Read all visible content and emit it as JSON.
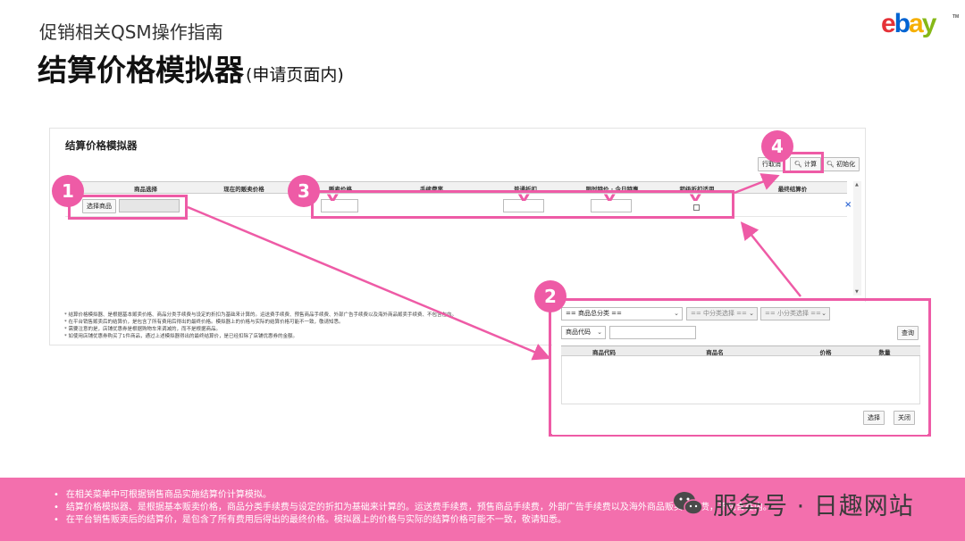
{
  "header": {
    "subtitle": "促销相关QSM操作指南",
    "title": "结算价格模拟器",
    "title_suffix": "(申请页面内)"
  },
  "logo": {
    "e": "e",
    "b": "b",
    "a": "a",
    "y": "y",
    "tm": "TM"
  },
  "simulator": {
    "title": "结算价格模拟器",
    "btn_add_row": "行取消",
    "btn_calculate": "计算",
    "btn_reset": "初始化",
    "columns": [
      "商品选择",
      "现在的贩卖价格",
      "贩卖价格",
      "手续费率",
      "普通折扣",
      "限时特价 · 今日特惠",
      "超级折扣适用",
      "最终结算价"
    ],
    "select_product_btn": "选择商品",
    "delete_icon": "×",
    "notes": [
      "* 结算价格模拟器、是根据基本贩卖价格、商品分类手续费与设定的折扣为基础来计算的。运送费手续费、预售商品手续费、外部广告手续费以及海外商品贩卖手续费、不包含在内。",
      "* 在平台销售贩卖后的结算价，是包含了所有费用后得出的最终价格。模拟器上的价格与实际的结算价格可能不一致，敬请知悉。",
      "* 需要注意的是，店铺优惠券是根据购物车来调减的，而不是根据商品。",
      "* 如使用店铺优惠券购买了1件商品，通过上述模拟器得出的最终结算价，是已经扣除了店铺优惠券的金额。"
    ]
  },
  "badges": [
    "1",
    "2",
    "3",
    "4"
  ],
  "popup": {
    "category_large": "== 商品总分类 ==",
    "category_mid": "== 中分类选择 ==",
    "category_small": "== 小分类选择 ==",
    "search_type": "商品代码",
    "search_button": "查询",
    "columns": [
      "商品代码",
      "商品名",
      "价格",
      "数量"
    ],
    "select_button": "选择",
    "close_button": "关闭"
  },
  "bottom_notes": [
    "在相关菜单中可根据销售商品实施结算价计算模拟。",
    "结算价格模拟器、是根据基本贩卖价格，商品分类手续费与设定的折扣为基础来计算的。运送费手续费，预售商品手续费，外部广告手续费以及海外商品贩卖手续费，不包含在内。",
    "在平台销售贩卖后的结算价，是包含了所有费用后得出的最终价格。模拟器上的价格与实际的结算价格可能不一致，敬请知悉。"
  ],
  "watermark": "服务号 · 日趣网站",
  "colors": {
    "highlight": "#ee5ba6",
    "bottom_bar": "#f36fad",
    "ebay_e": "#e53238",
    "ebay_b": "#0064d2",
    "ebay_a": "#f5af02",
    "ebay_y": "#86b817"
  }
}
